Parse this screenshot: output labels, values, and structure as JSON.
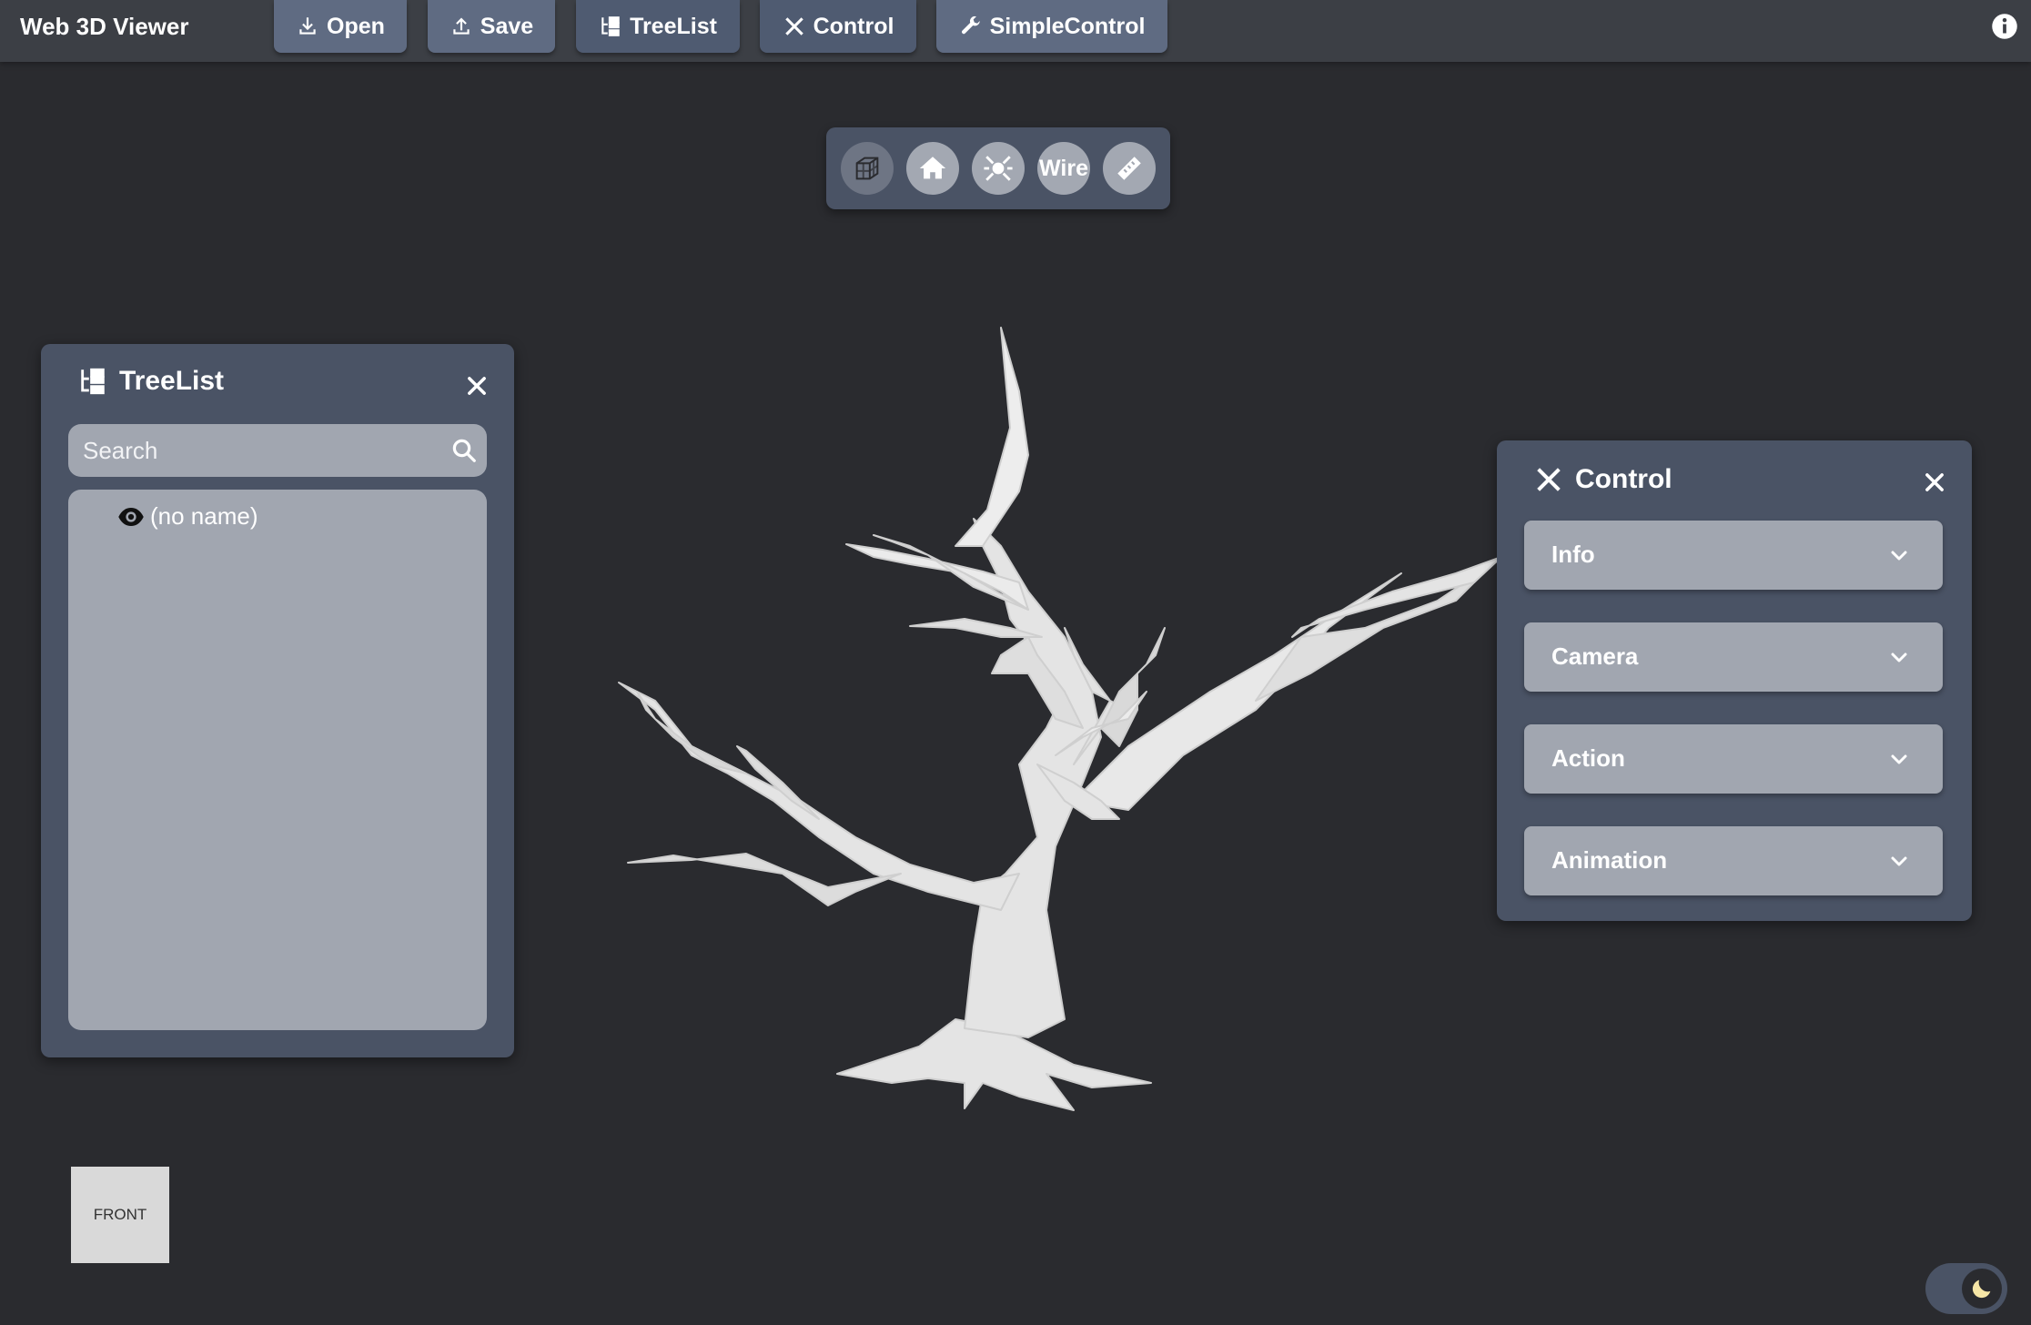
{
  "app": {
    "title": "Web 3D Viewer"
  },
  "toolbar": {
    "open_label": "Open",
    "save_label": "Save",
    "treelist_label": "TreeList",
    "control_label": "Control",
    "simplecontrol_label": "SimpleControl"
  },
  "view_toolbar": {
    "wire_label": "Wire",
    "icons": [
      "wireframe-cube-icon",
      "home-icon",
      "focus-icon",
      "wire-toggle",
      "ruler-icon"
    ]
  },
  "treelist": {
    "title": "TreeList",
    "search_placeholder": "Search",
    "items": [
      {
        "label": "(no name)",
        "icon": "eye-icon"
      }
    ]
  },
  "control": {
    "title": "Control",
    "sections": [
      {
        "label": "Info"
      },
      {
        "label": "Camera"
      },
      {
        "label": "Action"
      },
      {
        "label": "Animation"
      }
    ]
  },
  "view_cube": {
    "label": "FRONT"
  },
  "colors": {
    "background": "#2a2b2f",
    "topbar": "#3c3f45",
    "button": "#5f6b82",
    "panel": "#4a5365",
    "panel_field": "#a1a6b0",
    "model": "#e6e6e6"
  }
}
